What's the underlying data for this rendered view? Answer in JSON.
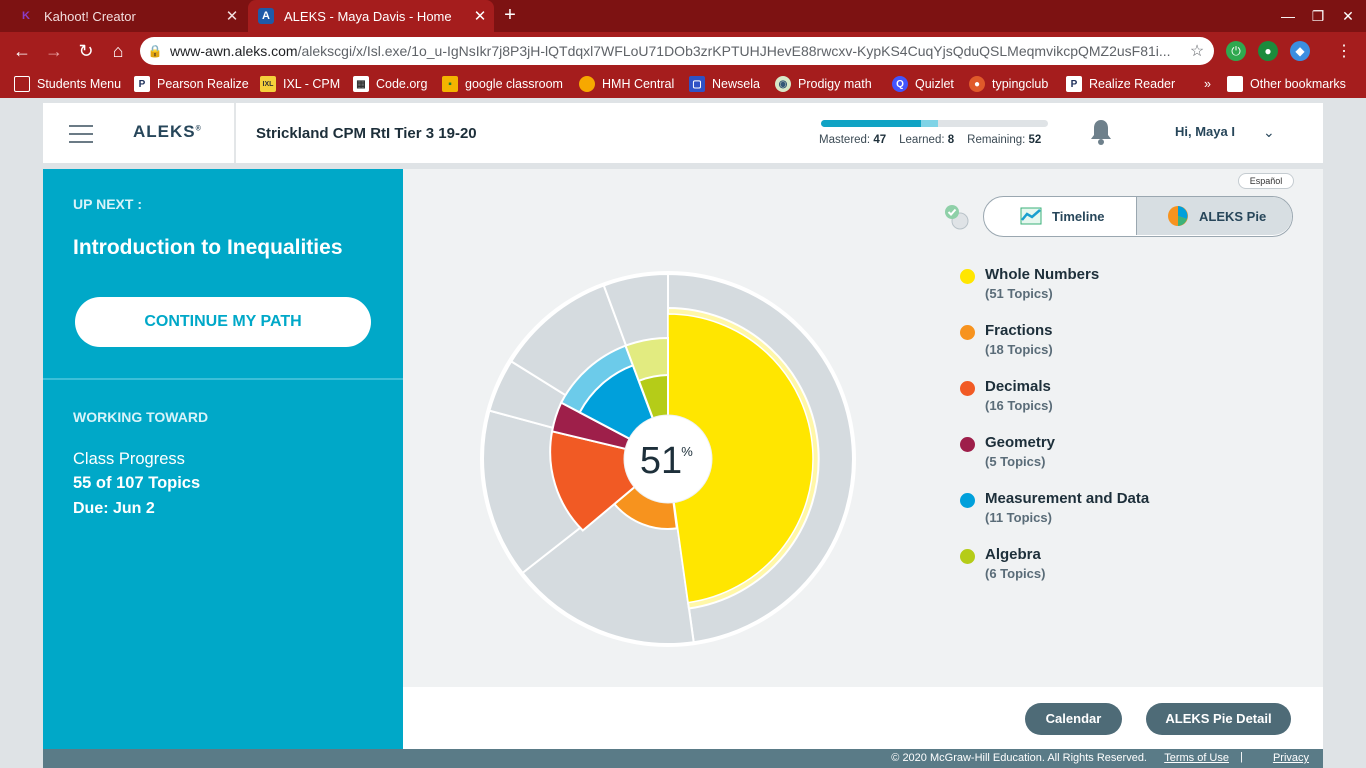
{
  "browser": {
    "tabs": [
      {
        "title": "Kahoot! Creator",
        "active": false
      },
      {
        "title": "ALEKS - Maya Davis - Home",
        "active": true
      }
    ],
    "url_host": "www-awn.aleks.com",
    "url_path": "/alekscgi/x/Isl.exe/1o_u-IgNsIkr7j8P3jH-lQTdqxl7WFLoU71DOb3zrKPTUHJHevE88rwcxv-KypKS4CuqYjsQduQSLMeqmvikcpQMZ2usF81i...",
    "bookmarks": [
      "Students Menu",
      "Pearson Realize",
      "IXL - CPM",
      "Code.org",
      "google classroom",
      "HMH Central",
      "Newsela",
      "Prodigy math",
      "Quizlet",
      "typingclub",
      "Realize Reader"
    ],
    "other_bookmarks": "Other bookmarks",
    "more_bookmarks": "»"
  },
  "header": {
    "logo": "ALEKS",
    "class_name": "Strickland CPM RtI Tier 3 19-20",
    "mastered_label": "Mastered:",
    "mastered": 47,
    "learned_label": "Learned:",
    "learned": 8,
    "remaining_label": "Remaining:",
    "remaining": 52,
    "user": "Hi, Maya I"
  },
  "sidebar": {
    "up_next_label": "UP NEXT :",
    "up_next_title": "Introduction to Inequalities",
    "continue_label": "CONTINUE MY PATH",
    "working_label": "WORKING TOWARD",
    "class_progress_label": "Class Progress",
    "topics": "55 of 107 Topics",
    "due": "Due: Jun 2"
  },
  "main": {
    "espanol": "Español",
    "timeline_label": "Timeline",
    "pie_label": "ALEKS Pie",
    "center_value": "51",
    "center_unit": "%",
    "legend": [
      {
        "name": "Whole Numbers",
        "count": "(51 Topics)",
        "color": "#ffe600"
      },
      {
        "name": "Fractions",
        "count": "(18 Topics)",
        "color": "#f7931e"
      },
      {
        "name": "Decimals",
        "count": "(16 Topics)",
        "color": "#f15a24"
      },
      {
        "name": "Geometry",
        "count": "(5 Topics)",
        "color": "#9e1f4a"
      },
      {
        "name": "Measurement and Data",
        "count": "(11 Topics)",
        "color": "#00a0db"
      },
      {
        "name": "Algebra",
        "count": "(6 Topics)",
        "color": "#b5cc18"
      }
    ]
  },
  "footer": {
    "calendar_label": "Calendar",
    "pie_detail_label": "ALEKS Pie Detail",
    "copyright": "© 2020 McGraw-Hill Education. All Rights Reserved.",
    "terms": "Terms of Use",
    "separator": "|",
    "privacy": "Privacy"
  },
  "colors": {
    "accent": "#00a8c8",
    "chrome": "#a51d1d",
    "gray_slice": "#d5dbdf"
  }
}
